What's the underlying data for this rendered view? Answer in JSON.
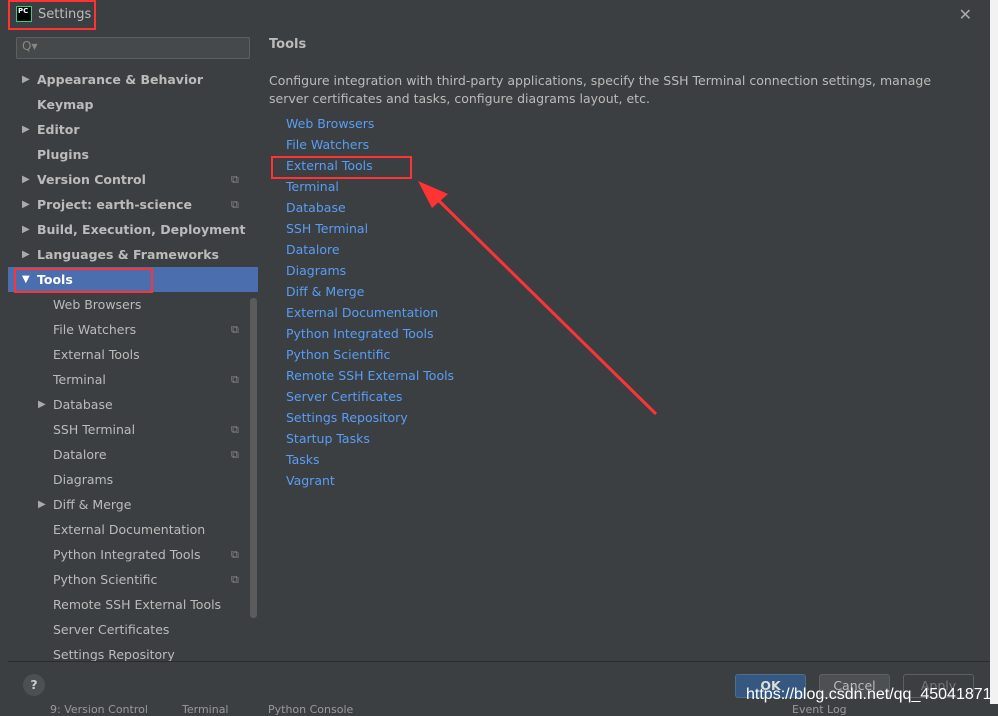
{
  "window": {
    "title": "Settings",
    "app_icon": "PC"
  },
  "search": {
    "placeholder": "Q▾"
  },
  "sidebar": {
    "items": [
      {
        "label": "Appearance & Behavior",
        "level": 0,
        "expand": "collapsed",
        "copy": false
      },
      {
        "label": "Keymap",
        "level": 0,
        "expand": "none",
        "copy": false
      },
      {
        "label": "Editor",
        "level": 0,
        "expand": "collapsed",
        "copy": false
      },
      {
        "label": "Plugins",
        "level": 0,
        "expand": "none",
        "copy": false
      },
      {
        "label": "Version Control",
        "level": 0,
        "expand": "collapsed",
        "copy": true
      },
      {
        "label": "Project: earth-science",
        "level": 0,
        "expand": "collapsed",
        "copy": true
      },
      {
        "label": "Build, Execution, Deployment",
        "level": 0,
        "expand": "collapsed",
        "copy": false
      },
      {
        "label": "Languages & Frameworks",
        "level": 0,
        "expand": "collapsed",
        "copy": false
      },
      {
        "label": "Tools",
        "level": 0,
        "expand": "expanded",
        "copy": false,
        "selected": true
      },
      {
        "label": "Web Browsers",
        "level": 1,
        "expand": "none",
        "copy": false
      },
      {
        "label": "File Watchers",
        "level": 1,
        "expand": "none",
        "copy": true
      },
      {
        "label": "External Tools",
        "level": 1,
        "expand": "none",
        "copy": false
      },
      {
        "label": "Terminal",
        "level": 1,
        "expand": "none",
        "copy": true
      },
      {
        "label": "Database",
        "level": 1,
        "expand": "collapsed",
        "copy": false
      },
      {
        "label": "SSH Terminal",
        "level": 1,
        "expand": "none",
        "copy": true
      },
      {
        "label": "Datalore",
        "level": 1,
        "expand": "none",
        "copy": true
      },
      {
        "label": "Diagrams",
        "level": 1,
        "expand": "none",
        "copy": false
      },
      {
        "label": "Diff & Merge",
        "level": 1,
        "expand": "collapsed",
        "copy": false
      },
      {
        "label": "External Documentation",
        "level": 1,
        "expand": "none",
        "copy": false
      },
      {
        "label": "Python Integrated Tools",
        "level": 1,
        "expand": "none",
        "copy": true
      },
      {
        "label": "Python Scientific",
        "level": 1,
        "expand": "none",
        "copy": true
      },
      {
        "label": "Remote SSH External Tools",
        "level": 1,
        "expand": "none",
        "copy": false
      },
      {
        "label": "Server Certificates",
        "level": 1,
        "expand": "none",
        "copy": false
      },
      {
        "label": "Settings Repository",
        "level": 1,
        "expand": "none",
        "copy": false
      }
    ]
  },
  "content": {
    "title": "Tools",
    "description": "Configure integration with third-party applications, specify the SSH Terminal connection settings, manage server certificates and tasks, configure diagrams layout, etc.",
    "links": [
      "Web Browsers",
      "File Watchers",
      "External Tools",
      "Terminal",
      "Database",
      "SSH Terminal",
      "Datalore",
      "Diagrams",
      "Diff & Merge",
      "External Documentation",
      "Python Integrated Tools",
      "Python Scientific",
      "Remote SSH External Tools",
      "Server Certificates",
      "Settings Repository",
      "Startup Tasks",
      "Tasks",
      "Vagrant"
    ]
  },
  "footer": {
    "help": "?",
    "ok": "OK",
    "cancel": "Cancel",
    "apply": "Apply"
  },
  "ide_bottom": {
    "version_control": "9: Version Control",
    "terminal": "Terminal",
    "python_console": "Python Console",
    "event_log": "Event Log"
  },
  "watermark": "https://blog.csdn.net/qq_45041871",
  "colors": {
    "accent": "#4b6eaf",
    "link": "#589df6",
    "annotation": "#ff3333"
  }
}
